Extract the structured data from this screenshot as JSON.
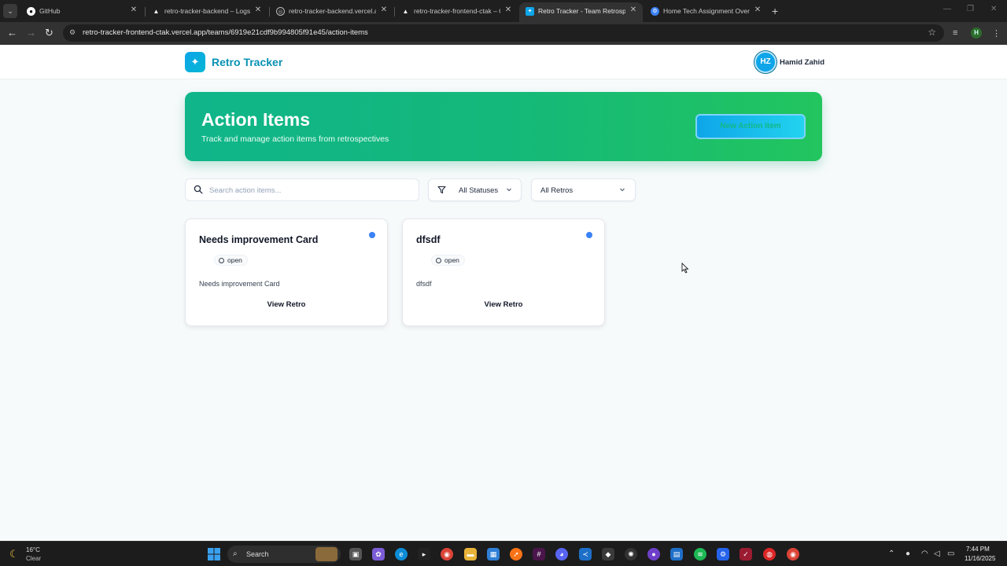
{
  "browser": {
    "tabs": [
      {
        "label": "GitHub",
        "icon": "github-icon"
      },
      {
        "label": "retro-tracker-backend – Logs –",
        "icon": "vercel-icon"
      },
      {
        "label": "retro-tracker-backend.vercel.ap",
        "icon": "globe-icon"
      },
      {
        "label": "retro-tracker-frontend-ctak – O",
        "icon": "vercel-icon"
      },
      {
        "label": "Retro Tracker - Team Retrospec",
        "icon": "retro-tracker-icon",
        "active": true
      },
      {
        "label": "Home Tech Assignment Overvi",
        "icon": "settings-icon"
      }
    ],
    "url": "retro-tracker-frontend-ctak.vercel.app/teams/6919e21cdf9b994805f91e45/action-items",
    "profile_initial": "H"
  },
  "app": {
    "brand": "Retro Tracker",
    "user": {
      "initials": "HZ",
      "name": "Hamid Zahid"
    }
  },
  "hero": {
    "title": "Action Items",
    "subtitle": "Track and manage action items from retrospectives",
    "new_button_label": "New Action Item"
  },
  "filters": {
    "search_placeholder": "Search action items...",
    "status_value": "All Statuses",
    "retro_value": "All Retros"
  },
  "cards": [
    {
      "title": "Needs improvement Card",
      "status": "open",
      "description": "Needs improvement Card",
      "link_label": "View Retro"
    },
    {
      "title": "dfsdf",
      "status": "open",
      "description": "dfsdf",
      "link_label": "View Retro"
    }
  ],
  "taskbar": {
    "weather_temp": "16°C",
    "weather_condition": "Clear",
    "search_label": "Search",
    "time": "7:44 PM",
    "date": "11/16/2025"
  },
  "colors": {
    "hero_gradient_start": "#10b58a",
    "hero_gradient_end": "#22c55e",
    "brand_text": "#0891b2",
    "status_dot": "#3b82f6"
  }
}
